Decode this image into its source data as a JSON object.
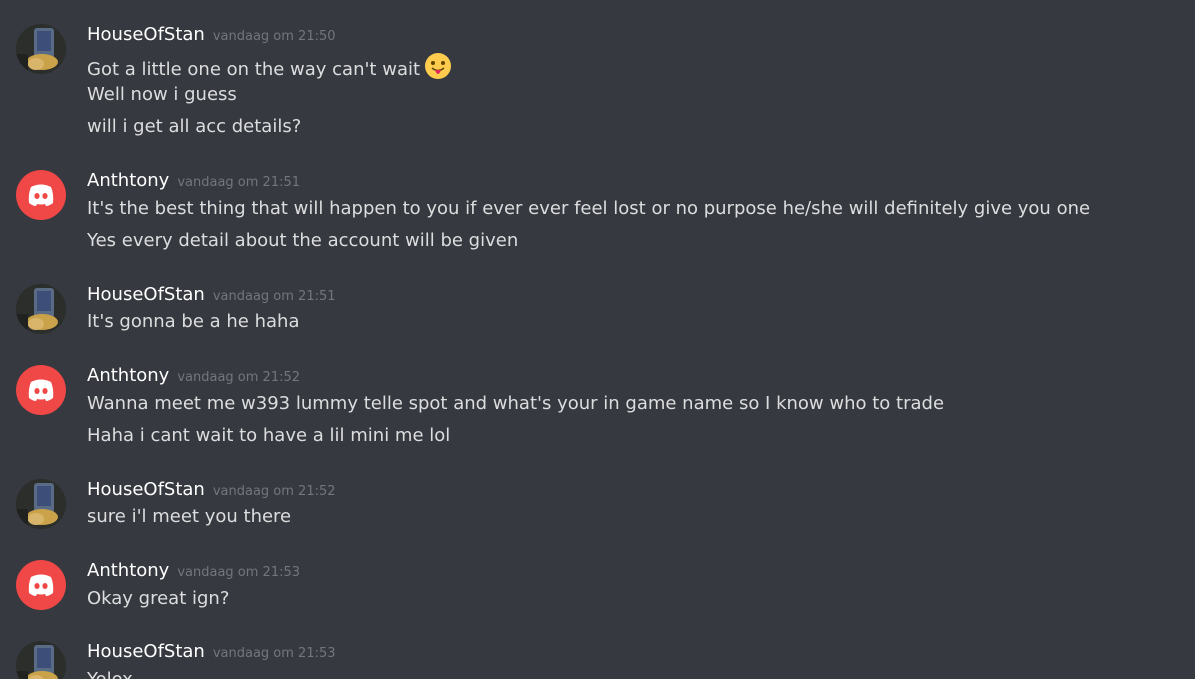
{
  "messages": [
    {
      "author": "HouseOfStan",
      "avatar": "photo-avatar",
      "timestamp": "vandaag om 21:50",
      "lines": [
        "Got a little one on the way can't wait",
        "Well now i guess",
        "will i get all acc details?"
      ],
      "emoji": "tongue-out-emoji"
    },
    {
      "author": "Anthtony",
      "avatar": "discord-logo-avatar",
      "timestamp": "vandaag om 21:51",
      "lines": [
        "It's the best thing that will happen to you if ever ever feel lost or no purpose he/she will definitely give you one",
        "Yes every detail about the account will be given"
      ]
    },
    {
      "author": "HouseOfStan",
      "avatar": "photo-avatar",
      "timestamp": "vandaag om 21:51",
      "lines": [
        "It's gonna be a he haha"
      ]
    },
    {
      "author": "Anthtony",
      "avatar": "discord-logo-avatar",
      "timestamp": "vandaag om 21:52",
      "lines": [
        "Wanna meet me w393 lummy telle spot and what's your in game name so I know who to trade",
        "Haha i cant wait to have a lil mini me lol"
      ]
    },
    {
      "author": "HouseOfStan",
      "avatar": "photo-avatar",
      "timestamp": "vandaag om 21:52",
      "lines": [
        "sure i'l meet you there"
      ]
    },
    {
      "author": "Anthtony",
      "avatar": "discord-logo-avatar",
      "timestamp": "vandaag om 21:53",
      "lines": [
        "Okay great ign?"
      ]
    },
    {
      "author": "HouseOfStan",
      "avatar": "photo-avatar",
      "timestamp": "vandaag om 21:53",
      "lines": [
        "Yolox"
      ]
    }
  ],
  "colors": {
    "background": "#36393f",
    "username": "#ffffff",
    "message_text": "#dcddde",
    "timestamp": "#72767d",
    "discord_avatar": "#f04747"
  }
}
